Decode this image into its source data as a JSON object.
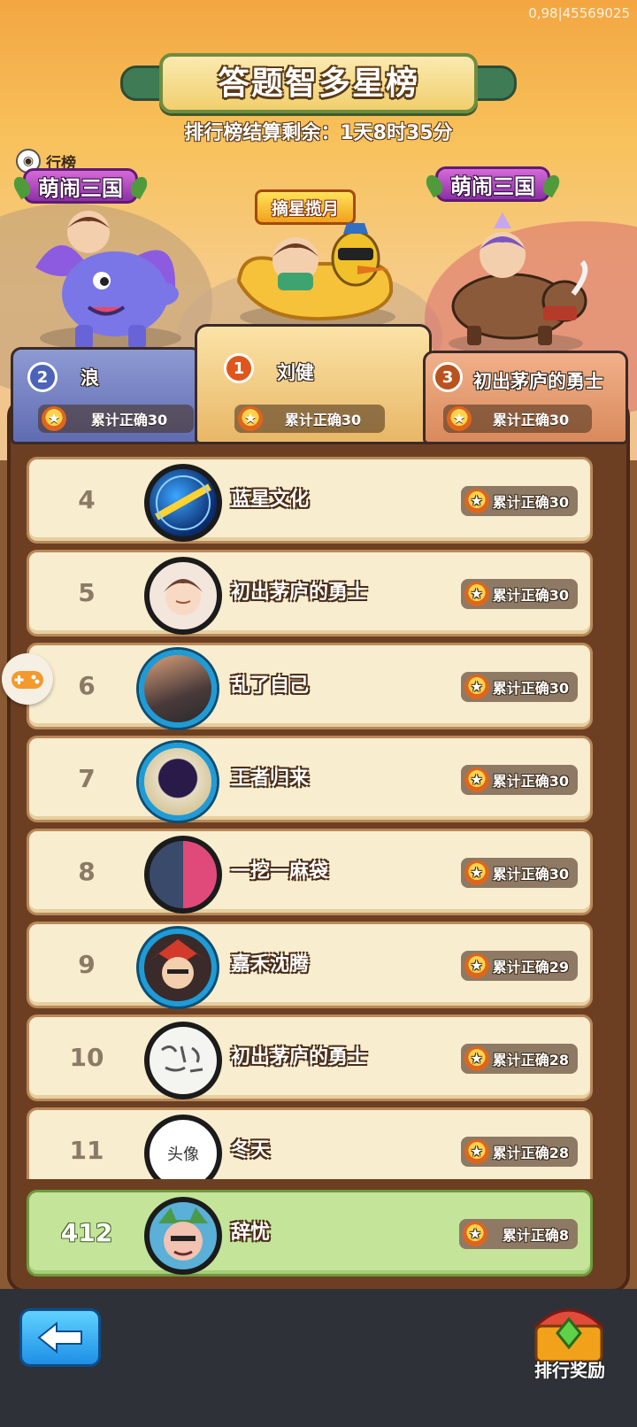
{
  "status": {
    "id_text": "0,98|45569025"
  },
  "header": {
    "title": "答题智多星榜",
    "countdown": "排行榜结算剩余：1天8时35分",
    "small_rank_label": "行榜"
  },
  "podium": {
    "first": {
      "rank": "1",
      "name": "刘健",
      "score": "累计正确30",
      "badge": "摘星揽月"
    },
    "second": {
      "rank": "2",
      "name": "浪",
      "score": "累计正确30",
      "tag": "萌闹三国"
    },
    "third": {
      "rank": "3",
      "name": "初出茅庐的勇士",
      "score": "累计正确30",
      "tag": "萌闹三国"
    }
  },
  "list": [
    {
      "rank": "4",
      "name": "蓝星文化",
      "score": "累计正确30",
      "avatar_style": "blue-globe"
    },
    {
      "rank": "5",
      "name": "初出茅庐的勇士",
      "score": "累计正确30",
      "avatar_style": "face"
    },
    {
      "rank": "6",
      "name": "乱了自己",
      "score": "累计正确30",
      "avatar_style": "photo",
      "framed": true
    },
    {
      "rank": "7",
      "name": "王者归来",
      "score": "累计正确30",
      "avatar_style": "dark-portal",
      "framed": true
    },
    {
      "rank": "8",
      "name": "一挖一麻袋",
      "score": "累计正确30",
      "avatar_style": "photo-red"
    },
    {
      "rank": "9",
      "name": "嘉禾沈腾",
      "score": "累计正确29",
      "avatar_style": "warrior",
      "framed": true
    },
    {
      "rank": "10",
      "name": "初出茅庐的勇士",
      "score": "累计正确28",
      "avatar_style": "calligraphy"
    },
    {
      "rank": "11",
      "name": "冬天",
      "score": "累计正确28",
      "avatar_style": "text",
      "avatar_text": "头像"
    }
  ],
  "me": {
    "rank": "412",
    "name": "辞忧",
    "score": "累计正确8"
  },
  "footer": {
    "reward_label": "排行奖励"
  },
  "colors": {
    "accent_gold": "#f2a11b",
    "row_bg": "#f9edcf",
    "me_row_bg": "#c4e49a",
    "back_button": "#1e8fe6"
  },
  "icons": [
    "back-arrow-icon",
    "star-medal-icon",
    "gamepad-icon",
    "treasure-chest-icon"
  ]
}
